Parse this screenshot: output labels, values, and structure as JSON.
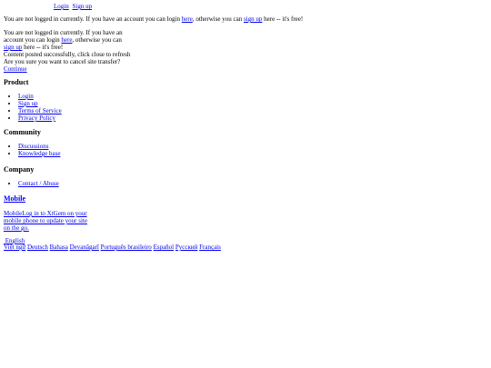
{
  "topnav": {
    "login": "Login",
    "signup": "Sign up"
  },
  "notice": {
    "part1": "You are not logged in currently. If you have an account you can login ",
    "here": "here",
    "part2": ", otherwise you can ",
    "signup": "sign up",
    "part3": " here -- it's free!"
  },
  "notice2": {
    "line1": "You are not logged in currently. If you have an account you can login ",
    "here": "here",
    "mid": ", otherwise you can ",
    "signup": "sign up",
    "end": " here -- it's free!",
    "posted": "Content posted successfully, click close to refresh",
    "confirm": "Are you sure you want to cancel site transfer?",
    "continue": "Continue"
  },
  "product": {
    "title": "Product",
    "items": [
      "Login",
      "Sign up",
      "Terms of Service",
      "Privacy Policy"
    ]
  },
  "community": {
    "title": "Community",
    "items": [
      "Discussions",
      "Knowledge base"
    ]
  },
  "company": {
    "title": "Company",
    "items": [
      "Contact / Abuse"
    ]
  },
  "mobile": {
    "title": "Mobile",
    "link_text": "MobileLog in to XtGem on your mobile phone to update your site on the go."
  },
  "language": {
    "current": "English",
    "options": [
      "Việt ngữ",
      "Deutsch",
      "Bahasa",
      "Devanāgarī",
      "Português brasileiro",
      "Español",
      "Русский",
      "Français"
    ]
  }
}
